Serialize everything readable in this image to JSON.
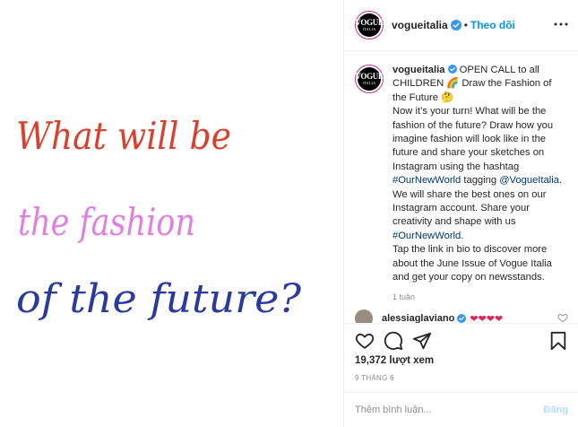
{
  "post": {
    "image": {
      "line1": "What will be",
      "line2": "the fashion",
      "line3": "of the future?",
      "colors": {
        "line1": "#d9412e",
        "line2": "#e07fe0",
        "line3": "#2b3a9e"
      }
    },
    "account": {
      "avatar_line1": "VOGUE",
      "avatar_line2": "ITALIA",
      "username": "vogueitalia",
      "separator": "•",
      "follow_label": "Theo dõi"
    },
    "caption": {
      "username": "vogueitalia",
      "text_lead": "OPEN CALL to all CHILDREN 🌈 Draw the Fashion of the Future 🤔",
      "text_body_1": "Now it’s your turn! What will be the fashion of the future? Draw how you imagine fashion will look like in the future and share your sketches on Instagram using the hashtag",
      "hashtag_1": "#OurNewWorld",
      "text_body_2": "tagging",
      "mention": "@VogueItalia",
      "text_body_3": ". We will share the best ones on our Instagram account. Share your creativity and shape with us",
      "hashtag_2": "#OurNewWorld",
      "text_body_4": ".",
      "text_body_5": "Tap the link in bio to discover more about the June Issue of Vogue Italia and get your copy on newsstands.",
      "time": "1 tuần"
    },
    "reply": {
      "username": "alessiaglaviano",
      "hearts": "❤❤❤❤"
    },
    "stats": {
      "views": "19,372 lượt xem",
      "date": "9 THÁNG 6"
    },
    "comment_box": {
      "placeholder": "Thêm bình luận...",
      "post_label": "Đăng"
    },
    "icons": {
      "like": "heart-icon",
      "comment": "comment-icon",
      "share": "share-icon",
      "save": "bookmark-icon",
      "more": "more-icon",
      "verified": "verified-icon"
    },
    "accent_color": "#0095f6"
  }
}
